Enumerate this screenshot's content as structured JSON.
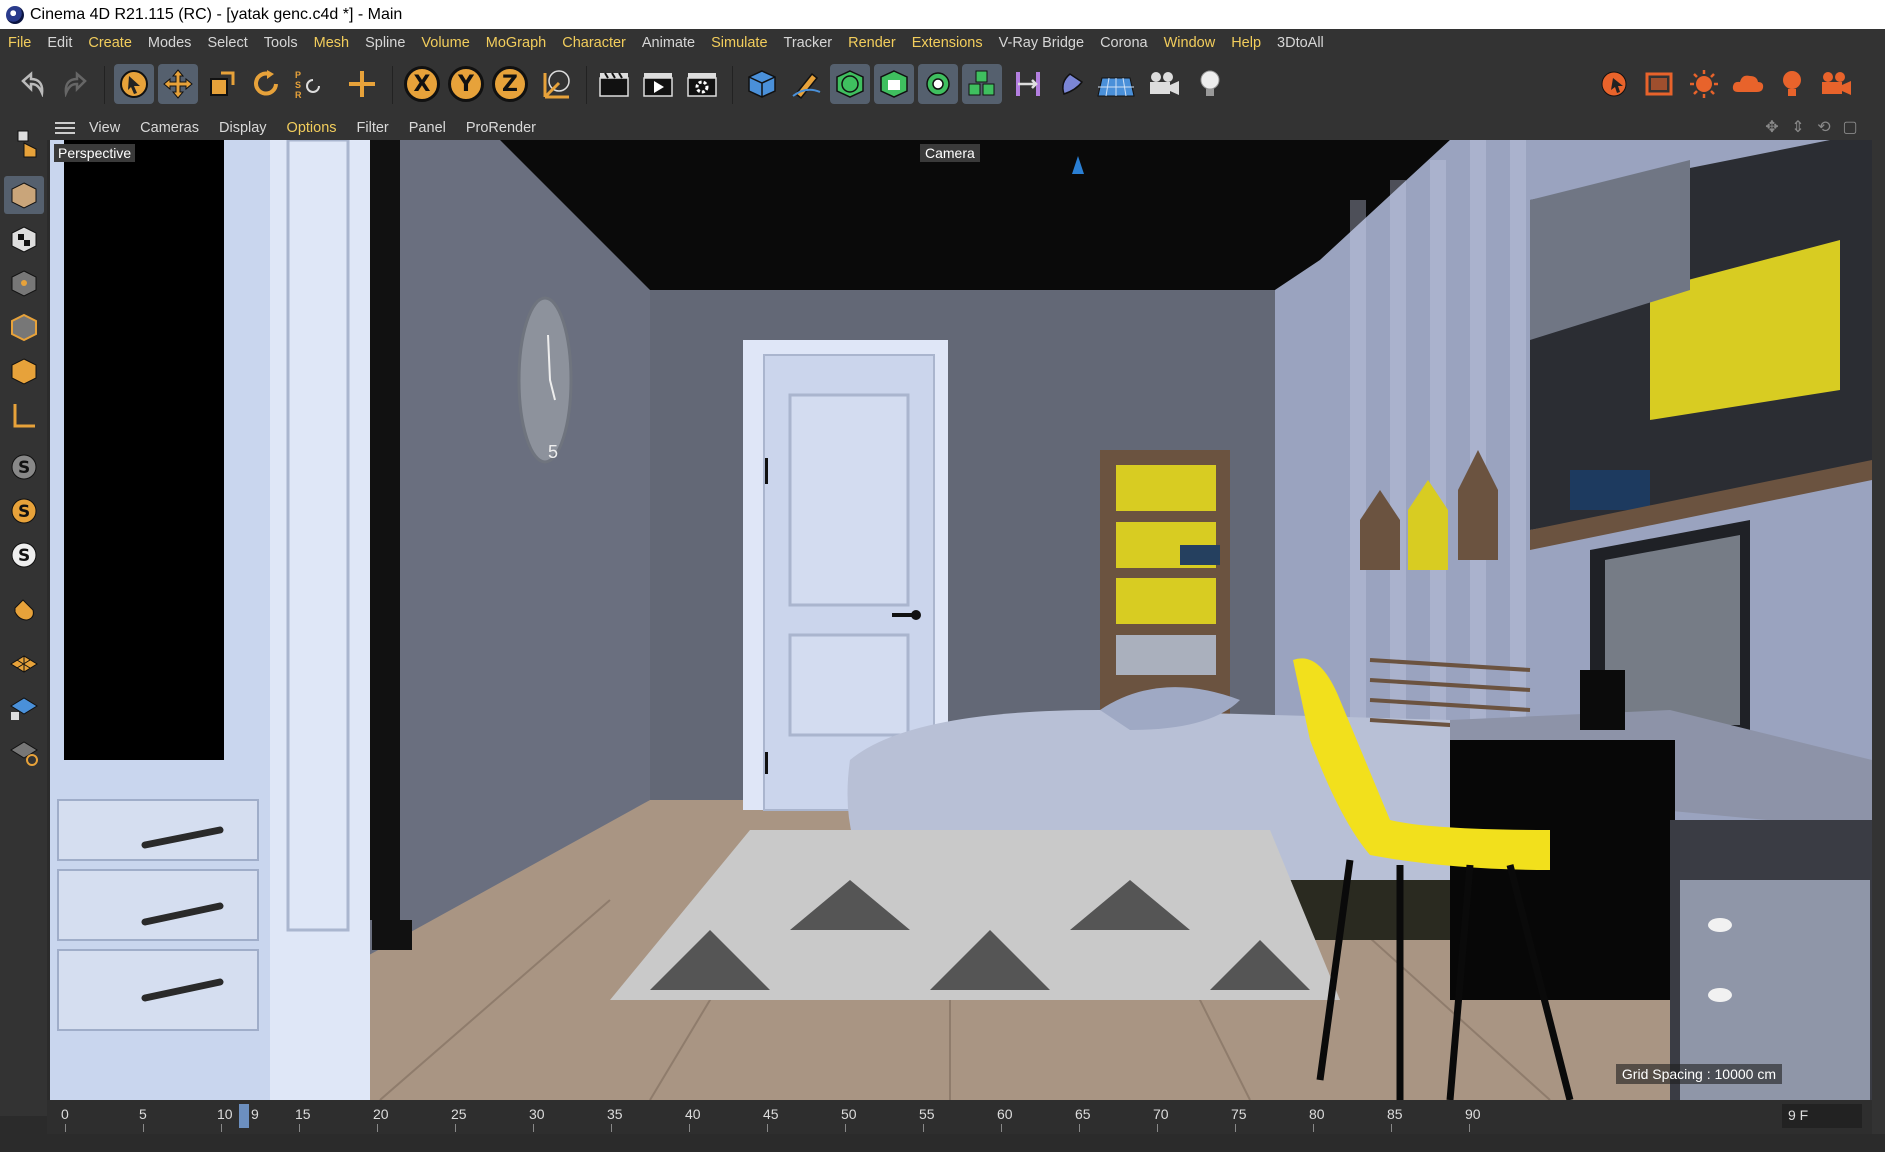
{
  "window": {
    "title": "Cinema 4D R21.115 (RC) - [yatak genc.c4d *] - Main"
  },
  "menubar": [
    {
      "label": "File",
      "style": "accent"
    },
    {
      "label": "Edit",
      "style": "plain"
    },
    {
      "label": "Create",
      "style": "accent"
    },
    {
      "label": "Modes",
      "style": "plain"
    },
    {
      "label": "Select",
      "style": "plain"
    },
    {
      "label": "Tools",
      "style": "plain"
    },
    {
      "label": "Mesh",
      "style": "accent"
    },
    {
      "label": "Spline",
      "style": "plain"
    },
    {
      "label": "Volume",
      "style": "accent"
    },
    {
      "label": "MoGraph",
      "style": "accent"
    },
    {
      "label": "Character",
      "style": "accent"
    },
    {
      "label": "Animate",
      "style": "plain"
    },
    {
      "label": "Simulate",
      "style": "accent"
    },
    {
      "label": "Tracker",
      "style": "plain"
    },
    {
      "label": "Render",
      "style": "accent"
    },
    {
      "label": "Extensions",
      "style": "accent"
    },
    {
      "label": "V-Ray Bridge",
      "style": "plain"
    },
    {
      "label": "Corona",
      "style": "plain"
    },
    {
      "label": "Window",
      "style": "accent"
    },
    {
      "label": "Help",
      "style": "accent"
    },
    {
      "label": "3DtoAll",
      "style": "plain"
    }
  ],
  "toolbar": {
    "undo_icon": "undo-icon",
    "redo_icon": "redo-icon",
    "axis_x": "X",
    "axis_y": "Y",
    "axis_z": "Z",
    "accent_color": "#e7a23a"
  },
  "viewport_menu": [
    {
      "label": "View",
      "style": "plain"
    },
    {
      "label": "Cameras",
      "style": "plain"
    },
    {
      "label": "Display",
      "style": "plain"
    },
    {
      "label": "Options",
      "style": "accent"
    },
    {
      "label": "Filter",
      "style": "plain"
    },
    {
      "label": "Panel",
      "style": "plain"
    },
    {
      "label": "ProRender",
      "style": "plain"
    }
  ],
  "viewport": {
    "view_name": "Perspective",
    "camera_label": "Camera",
    "grid_spacing": "Grid Spacing : 10000 cm"
  },
  "timeline": {
    "ticks": [
      "0",
      "5",
      "10",
      "15",
      "20",
      "25",
      "30",
      "35",
      "40",
      "45",
      "50",
      "55",
      "60",
      "65",
      "70",
      "75",
      "80",
      "85",
      "90"
    ],
    "current_frame": "9 F",
    "marker_label": "9"
  },
  "colors": {
    "ui_background": "#333333",
    "menu_accent": "#f2cd5c",
    "selection": "#55606e"
  }
}
